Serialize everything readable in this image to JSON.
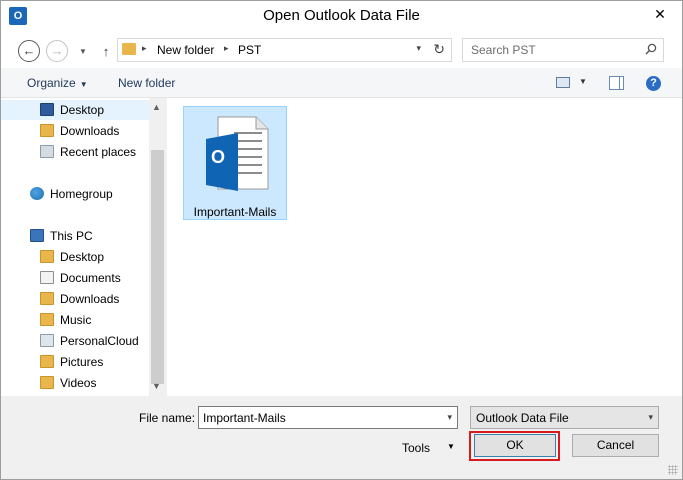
{
  "window": {
    "title": "Open Outlook Data File",
    "app_icon_text": "O",
    "close_glyph": "✕"
  },
  "nav": {
    "back": "←",
    "forward": "→",
    "up": "↑",
    "recent": "▼"
  },
  "address": {
    "segments": [
      "New folder",
      "PST"
    ],
    "separator": "▸",
    "dropdown": "▾",
    "refresh": "↻"
  },
  "search": {
    "placeholder": "Search PST"
  },
  "toolbar": {
    "organize": "Organize",
    "organize_caret": "▼",
    "new_folder": "New folder",
    "view_caret": "▼",
    "help": "?"
  },
  "navpane": {
    "quick_access": [
      {
        "label": "Desktop",
        "icon": "desktop-icon",
        "selected": true
      },
      {
        "label": "Downloads",
        "icon": "downloads-folder-icon"
      },
      {
        "label": "Recent places",
        "icon": "recent-places-icon"
      }
    ],
    "homegroup": {
      "label": "Homegroup",
      "icon": "homegroup-icon"
    },
    "this_pc": {
      "label": "This PC",
      "icon": "computer-icon"
    },
    "pc_items": [
      {
        "label": "Desktop",
        "icon": "desktop-folder-icon"
      },
      {
        "label": "Documents",
        "icon": "documents-folder-icon"
      },
      {
        "label": "Downloads",
        "icon": "downloads-folder-icon"
      },
      {
        "label": "Music",
        "icon": "music-folder-icon"
      },
      {
        "label": "PersonalCloud",
        "icon": "network-drive-icon"
      },
      {
        "label": "Pictures",
        "icon": "pictures-folder-icon"
      },
      {
        "label": "Videos",
        "icon": "videos-folder-icon"
      }
    ],
    "scroll_up": "▲",
    "scroll_down": "▼"
  },
  "files": [
    {
      "name": "Important-Mails",
      "icon": "outlook-data-file-icon",
      "badge": "O",
      "selected": true
    }
  ],
  "bottom": {
    "file_name_label": "File name:",
    "file_name_value": "Important-Mails",
    "file_type": "Outlook Data File",
    "caret": "▾",
    "tools_label": "Tools",
    "tools_caret": "▼",
    "ok_label": "OK",
    "cancel_label": "Cancel"
  },
  "colors": {
    "selection": "#cce8ff",
    "highlight_box": "#d9191d",
    "outlook_blue": "#0f64b4"
  }
}
